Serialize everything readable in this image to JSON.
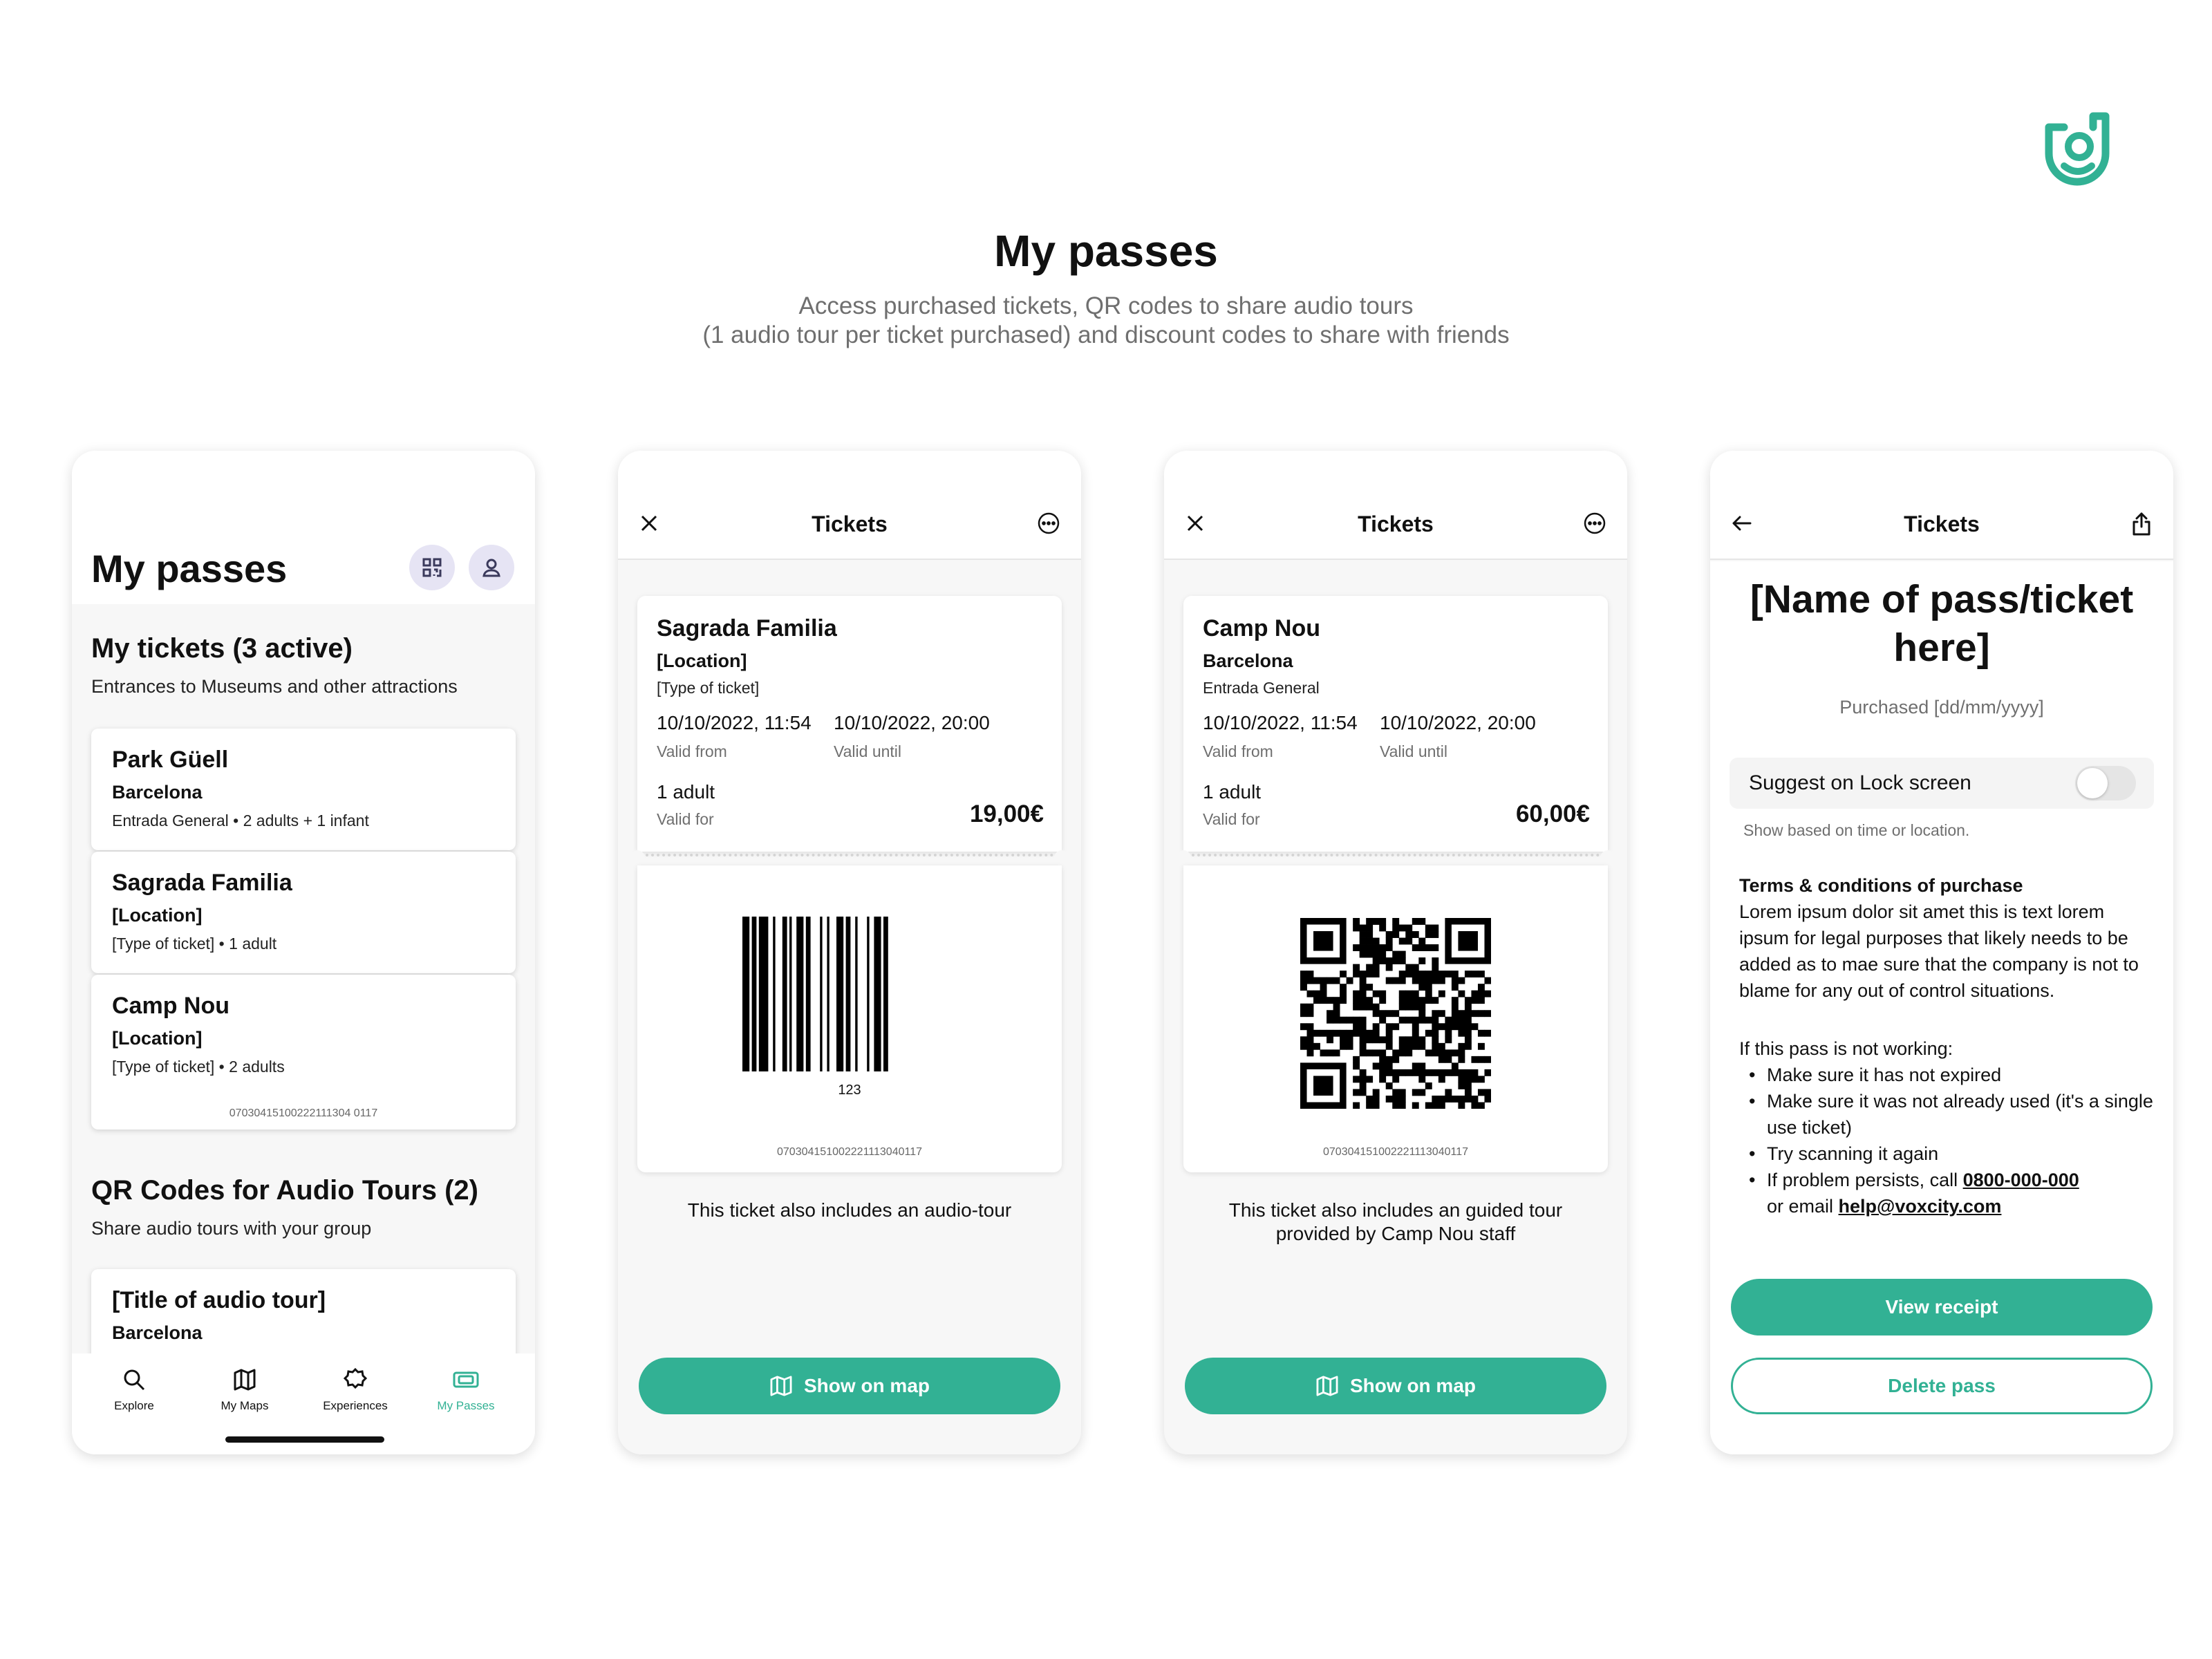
{
  "header": {
    "title": "My passes",
    "subtitle_line1": "Access purchased tickets, QR codes to share audio tours",
    "subtitle_line2": "(1 audio tour per ticket purchased) and discount codes to share with friends"
  },
  "brand": {
    "accent": "#32b194",
    "logo_icon": "voxcity-logo-icon"
  },
  "screen1": {
    "title": "My passes",
    "tickets_section": {
      "title": "My tickets (3 active)",
      "subtitle": "Entrances to Museums and other attractions"
    },
    "tickets": [
      {
        "name": "Park Güell",
        "location": "Barcelona",
        "type": "Entrada General",
        "people": "2 adults + 1 infant"
      },
      {
        "name": "Sagrada Familia",
        "location": "[Location]",
        "type": "[Type of ticket]",
        "people": "1 adult"
      },
      {
        "name": "Camp Nou",
        "location": "[Location]",
        "type": "[Type of ticket]",
        "people": "2 adults",
        "code": "07030415100222111304 0117"
      }
    ],
    "qr_section": {
      "title": "QR Codes for Audio Tours (2)",
      "subtitle": "Share audio tours with your group"
    },
    "audio_tour": {
      "name": "[Title of audio tour]",
      "location": "Barcelona"
    },
    "tabs": [
      {
        "label": "Explore",
        "icon": "search-icon"
      },
      {
        "label": "My Maps",
        "icon": "map-icon"
      },
      {
        "label": "Experiences",
        "icon": "badge-icon"
      },
      {
        "label": "My Passes",
        "icon": "ticket-icon",
        "active": true
      }
    ]
  },
  "screen2": {
    "nav_title": "Tickets",
    "ticket": {
      "name": "Sagrada Familia",
      "location": "[Location]",
      "type": "[Type of ticket]",
      "valid_from": "10/10/2022, 11:54",
      "valid_from_label": "Valid from",
      "valid_until": "10/10/2022, 20:00",
      "valid_until_label": "Valid until",
      "people": "1 adult",
      "people_label": "Valid for",
      "price": "19,00€",
      "barcode_number": "123",
      "code": "070304151002221113040117"
    },
    "includes": "This ticket also includes an audio-tour",
    "button": "Show on map"
  },
  "screen3": {
    "nav_title": "Tickets",
    "ticket": {
      "name": "Camp Nou",
      "location": "Barcelona",
      "type": "Entrada General",
      "valid_from": "10/10/2022, 11:54",
      "valid_from_label": "Valid from",
      "valid_until": "10/10/2022, 20:00",
      "valid_until_label": "Valid until",
      "people": "1 adult",
      "people_label": "Valid for",
      "price": "60,00€",
      "code": "070304151002221113040117"
    },
    "includes_line1": "This ticket also includes an guided tour",
    "includes_line2": "provided by Camp Nou staff",
    "button": "Show on map"
  },
  "screen4": {
    "nav_title": "Tickets",
    "pass_name_line1": "[Name of pass/ticket",
    "pass_name_line2": "here]",
    "purchased": "Purchased [dd/mm/yyyy]",
    "lock_screen": {
      "label": "Suggest on Lock screen",
      "hint": "Show based on time or location.",
      "enabled": false
    },
    "terms_title": "Terms & conditions of purchase",
    "terms_body": "Lorem ipsum dolor sit amet this is text lorem ipsum for legal purposes that likely needs to be added as to mae sure that the company is not to blame for any out of control situations.",
    "help_intro": "If this pass is not working:",
    "help_items": [
      "Make sure it has not expired",
      "Make sure it was not already used (it's a single use ticket)",
      "Try scanning it again"
    ],
    "help_call_prefix": "If problem persists, call ",
    "help_phone": "0800-000-000",
    "help_email_prefix": "or email ",
    "help_email": "help@voxcity.com",
    "primary_button": "View receipt",
    "secondary_button": "Delete pass"
  }
}
